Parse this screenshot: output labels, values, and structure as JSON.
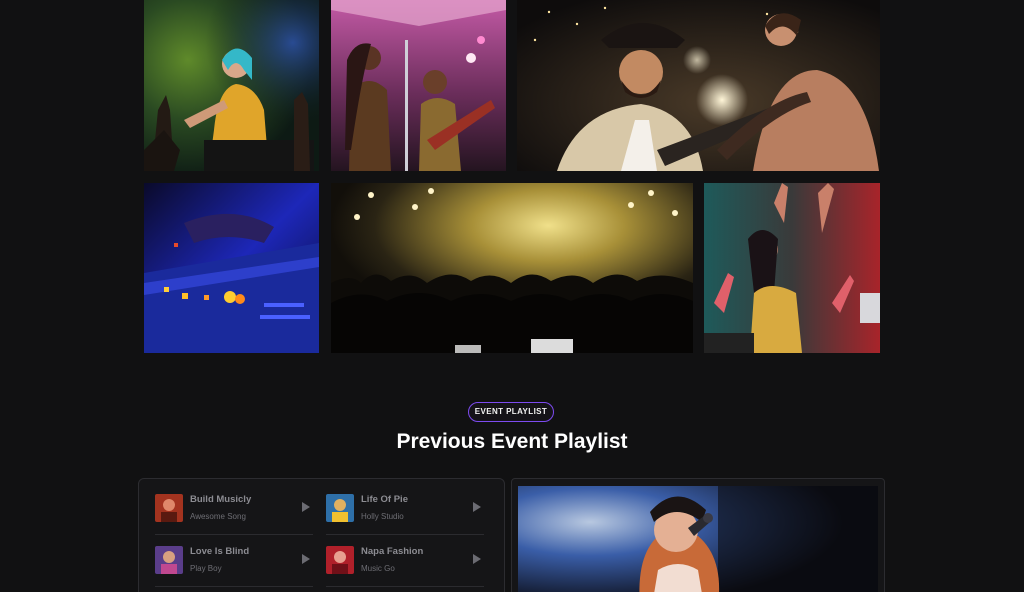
{
  "gallery": {
    "items": [
      {
        "name": "gallery-photo-green-smoke-singer",
        "icon": "concert-photo"
      },
      {
        "name": "gallery-photo-pink-stage-band",
        "icon": "concert-photo"
      },
      {
        "name": "gallery-photo-guitarists",
        "icon": "concert-photo"
      },
      {
        "name": "gallery-photo-dj-mixer",
        "icon": "concert-photo"
      },
      {
        "name": "gallery-photo-crowd-lights",
        "icon": "concert-photo"
      },
      {
        "name": "gallery-photo-dancer-red-smoke",
        "icon": "concert-photo"
      }
    ]
  },
  "playlist_section": {
    "badge": "EVENT PLAYLIST",
    "title": "Previous Event Playlist",
    "tracks": [
      {
        "title": "Build Musicly",
        "artist": "Awesome Song",
        "thumb_color": "#a3331f"
      },
      {
        "title": "Life Of Pie",
        "artist": "Holly Studio",
        "thumb_color": "#2e6fa8"
      },
      {
        "title": "Love Is Blind",
        "artist": "Play Boy",
        "thumb_color": "#5a3d8a"
      },
      {
        "title": "Napa Fashion",
        "artist": "Music Go",
        "thumb_color": "#b0202a"
      }
    ]
  },
  "colors": {
    "background": "#111112",
    "accent": "#7d4bf0",
    "panel_border": "#2c2c30"
  }
}
